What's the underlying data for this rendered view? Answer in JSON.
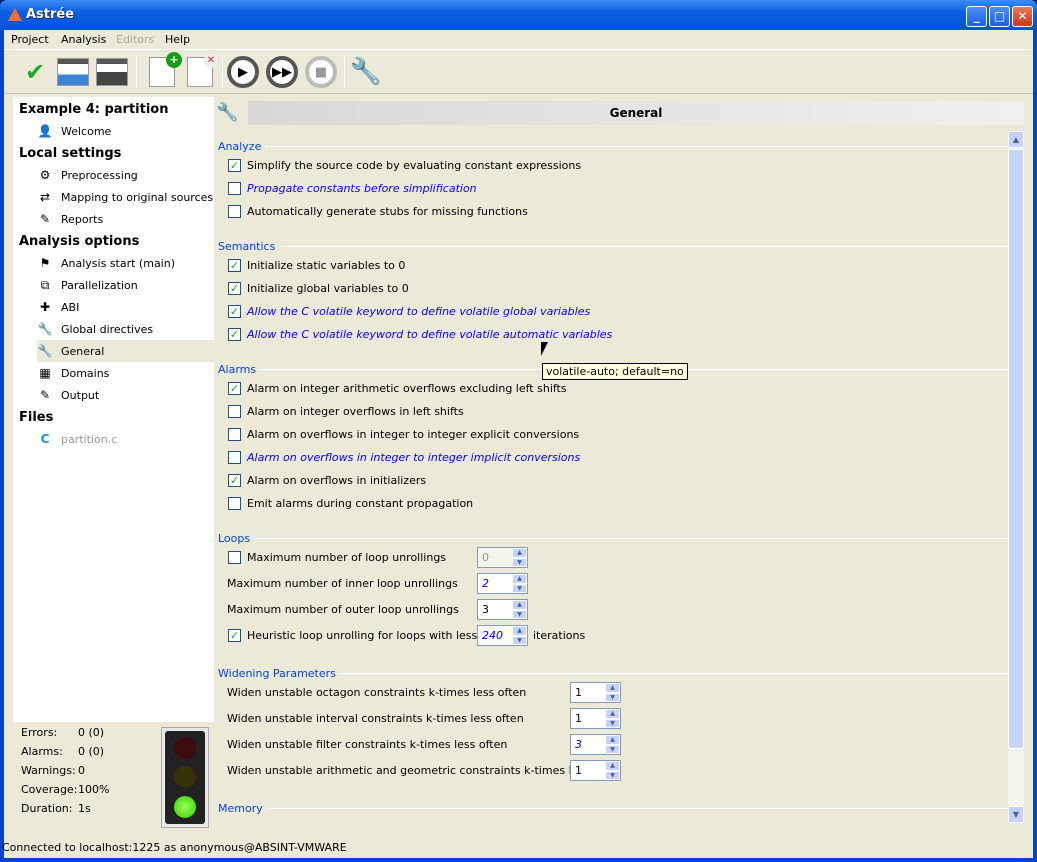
{
  "window": {
    "title": "Astrée"
  },
  "menu": [
    "Project",
    "Analysis",
    "Editors",
    "Help"
  ],
  "toolbar": [
    "connect-icon",
    "open-project-icon",
    "save-project-icon",
    "add-file-icon",
    "remove-file-icon",
    "start-analysis-icon",
    "resume-analysis-icon",
    "stop-analysis-icon",
    "settings-wrench-icon"
  ],
  "sidebar": {
    "groups": [
      {
        "title": "Example 4: partition",
        "items": [
          {
            "label": "Welcome",
            "icon": "user-info-icon"
          }
        ]
      },
      {
        "title": "Local settings",
        "items": [
          {
            "label": "Preprocessing",
            "icon": "gear-icon"
          },
          {
            "label": "Mapping to original sources",
            "icon": "mapping-icon"
          },
          {
            "label": "Reports",
            "icon": "pencil-icon"
          }
        ]
      },
      {
        "title": "Analysis options",
        "items": [
          {
            "label": "Analysis start (main)",
            "icon": "flag-icon"
          },
          {
            "label": "Parallelization",
            "icon": "parallel-icon"
          },
          {
            "label": "ABI",
            "icon": "puzzle-icon"
          },
          {
            "label": "Global directives",
            "icon": "wrench-icon"
          },
          {
            "label": "General",
            "icon": "wrench-icon",
            "selected": true
          },
          {
            "label": "Domains",
            "icon": "domains-icon"
          },
          {
            "label": "Output",
            "icon": "pencil-icon"
          }
        ]
      },
      {
        "title": "Files",
        "items": [
          {
            "label": "partition.c",
            "icon": "c-file-icon",
            "disabled": true
          }
        ]
      }
    ]
  },
  "stats": [
    {
      "label": "Errors:",
      "value": "0 (0)"
    },
    {
      "label": "Alarms:",
      "value": "0 (0)"
    },
    {
      "label": "Warnings:",
      "value": "0"
    },
    {
      "label": "Coverage:",
      "value": "100%"
    },
    {
      "label": "Duration:",
      "value": "1s"
    }
  ],
  "traffic_light": "green",
  "status": "Connected to localhost:1225 as anonymous@ABSINT-VMWARE",
  "panel": {
    "title": "General",
    "sections": [
      {
        "title": "Analyze",
        "rows": [
          {
            "type": "check",
            "label": "Simplify the source code by evaluating constant expressions",
            "checked": true
          },
          {
            "type": "check",
            "label": "Propagate constants before simplification",
            "checked": false,
            "modified": true
          },
          {
            "type": "check",
            "label": "Automatically generate stubs for missing functions",
            "checked": false
          }
        ]
      },
      {
        "title": "Semantics",
        "rows": [
          {
            "type": "check",
            "label": "Initialize static variables to 0",
            "checked": true
          },
          {
            "type": "check",
            "label": "Initialize global variables to 0",
            "checked": true
          },
          {
            "type": "check",
            "label": "Allow the C volatile keyword to define volatile global variables",
            "checked": true,
            "modified": true
          },
          {
            "type": "check",
            "label": "Allow the C volatile keyword to define volatile automatic variables",
            "checked": true,
            "modified": true
          }
        ]
      },
      {
        "title": "Alarms",
        "rows": [
          {
            "type": "check",
            "label": "Alarm on integer arithmetic overflows excluding left shifts",
            "checked": true
          },
          {
            "type": "check",
            "label": "Alarm on integer overflows in left shifts",
            "checked": false
          },
          {
            "type": "check",
            "label": "Alarm on overflows in integer to integer explicit conversions",
            "checked": false
          },
          {
            "type": "check",
            "label": "Alarm on overflows in integer to integer implicit conversions",
            "checked": false,
            "modified": true
          },
          {
            "type": "check",
            "label": "Alarm on overflows in initializers",
            "checked": true
          },
          {
            "type": "check",
            "label": "Emit alarms during constant propagation",
            "checked": false
          }
        ]
      },
      {
        "title": "Loops",
        "rows": [
          {
            "type": "checkspin",
            "label": "Maximum number of loop unrollings",
            "checked": false,
            "value": "0",
            "disabled": true
          },
          {
            "type": "spin",
            "label": "Maximum number of inner loop unrollings",
            "value": "2",
            "modified": true
          },
          {
            "type": "spin",
            "label": "Maximum number of outer loop unrollings",
            "value": "3"
          },
          {
            "type": "checkspin",
            "label": "Heuristic loop unrolling for loops with less than",
            "checked": true,
            "value": "240",
            "modified": true,
            "suffix": "iterations"
          }
        ]
      },
      {
        "title": "Widening Parameters",
        "rows": [
          {
            "type": "spin",
            "label": "Widen unstable octagon constraints k-times less often",
            "value": "1"
          },
          {
            "type": "spin",
            "label": "Widen unstable interval constraints k-times less often",
            "value": "1"
          },
          {
            "type": "spin",
            "label": "Widen unstable filter constraints k-times less often",
            "value": "3",
            "modified": true
          },
          {
            "type": "spin",
            "label": "Widen unstable arithmetic and geometric constraints k-times less often",
            "value": "1"
          }
        ]
      },
      {
        "title": "Memory",
        "rows": []
      }
    ]
  },
  "tooltip": "volatile-auto; default=no"
}
